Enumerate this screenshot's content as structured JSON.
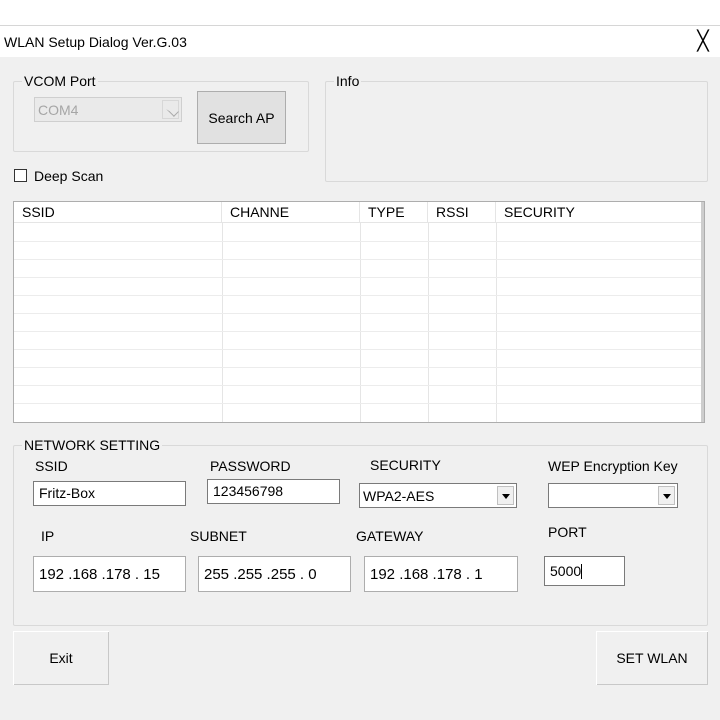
{
  "window": {
    "title": "WLAN Setup Dialog Ver.G.03",
    "close_glyph": "╳"
  },
  "vcom": {
    "group_label": "VCOM Port",
    "port_value": "COM4",
    "search_button": "Search AP"
  },
  "info": {
    "group_label": "Info"
  },
  "deep_scan": {
    "label": "Deep Scan",
    "checked": false
  },
  "ap_list": {
    "columns": [
      "SSID",
      "CHANNE",
      "TYPE",
      "RSSI",
      "SECURITY"
    ],
    "rows": []
  },
  "network": {
    "group_label": "NETWORK SETTING",
    "ssid_label": "SSID",
    "ssid_value": "Fritz-Box",
    "password_label": "PASSWORD",
    "password_value": "123456798",
    "security_label": "SECURITY",
    "security_value": "WPA2-AES",
    "wep_label": "WEP Encryption Key",
    "wep_value": "",
    "ip_label": "IP",
    "ip_value": "192 .168 .178 . 15",
    "subnet_label": "SUBNET",
    "subnet_value": "255 .255 .255 .  0",
    "gateway_label": "GATEWAY",
    "gateway_value": "192 .168 .178 .  1",
    "port_label": "PORT",
    "port_value": "5000"
  },
  "footer": {
    "exit_button": "Exit",
    "set_button": "SET WLAN"
  }
}
